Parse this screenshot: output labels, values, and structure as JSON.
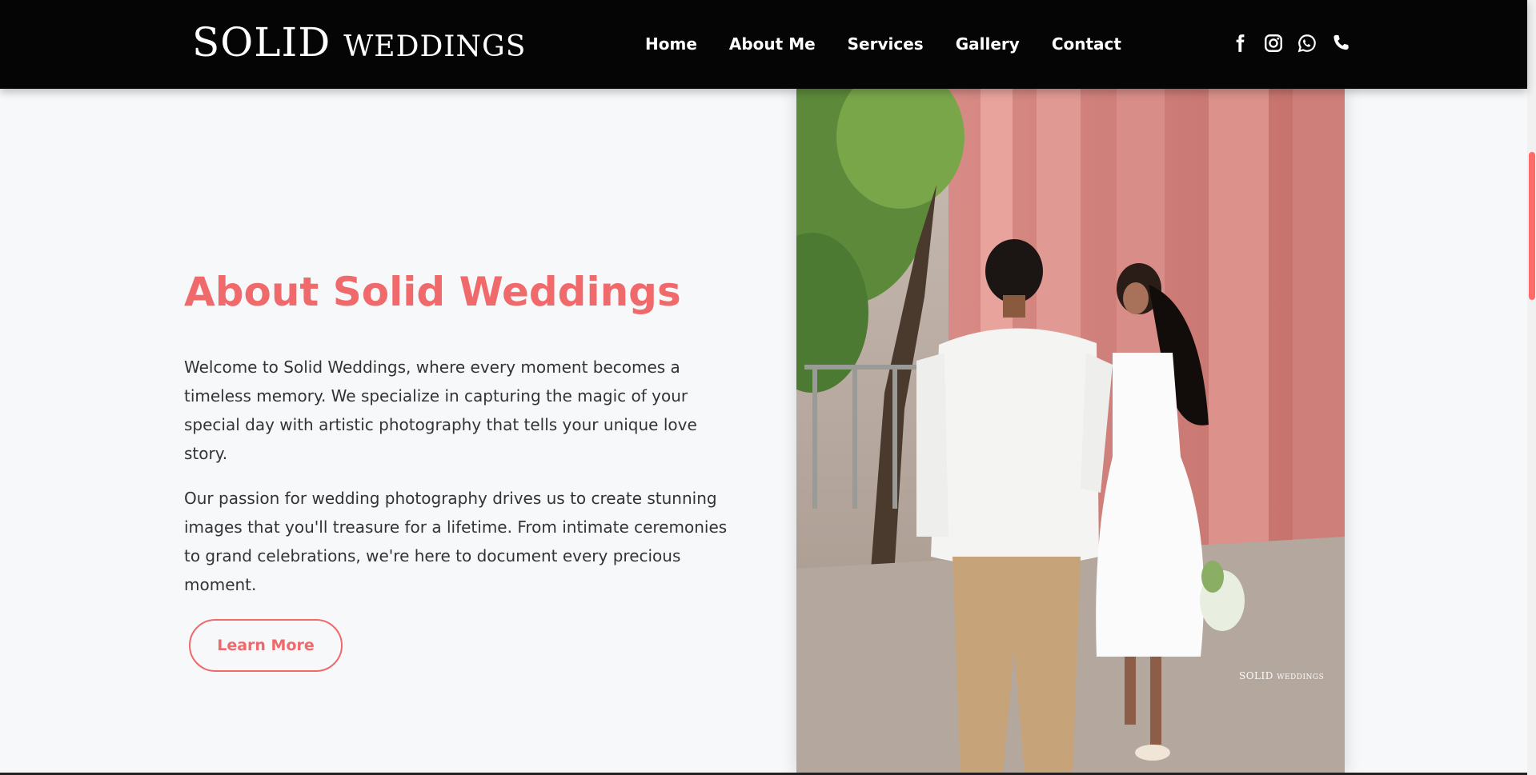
{
  "header": {
    "logo_main": "SOLID",
    "logo_sub": "WEDDINGS",
    "nav": [
      "Home",
      "About Me",
      "Services",
      "Gallery",
      "Contact"
    ],
    "social_icons": [
      "facebook-icon",
      "instagram-icon",
      "whatsapp-icon",
      "phone-icon"
    ]
  },
  "about": {
    "title": "About Solid Weddings",
    "paragraph_1": "Welcome to Solid Weddings, where every moment becomes a timeless memory. We specialize in capturing the magic of your special day with artistic photography that tells your unique love story.",
    "paragraph_2": "Our passion for wedding photography drives us to create stunning images that you'll treasure for a lifetime. From intimate ceremonies to grand celebrations, we're here to document every precious moment.",
    "button_label": "Learn More"
  },
  "photo": {
    "watermark_main": "SOLID",
    "watermark_sub": "WEDDINGS"
  },
  "colors": {
    "accent": "#f0696b",
    "header_bg": "#050505",
    "page_bg": "#f6f8fa",
    "text": "#333333"
  }
}
